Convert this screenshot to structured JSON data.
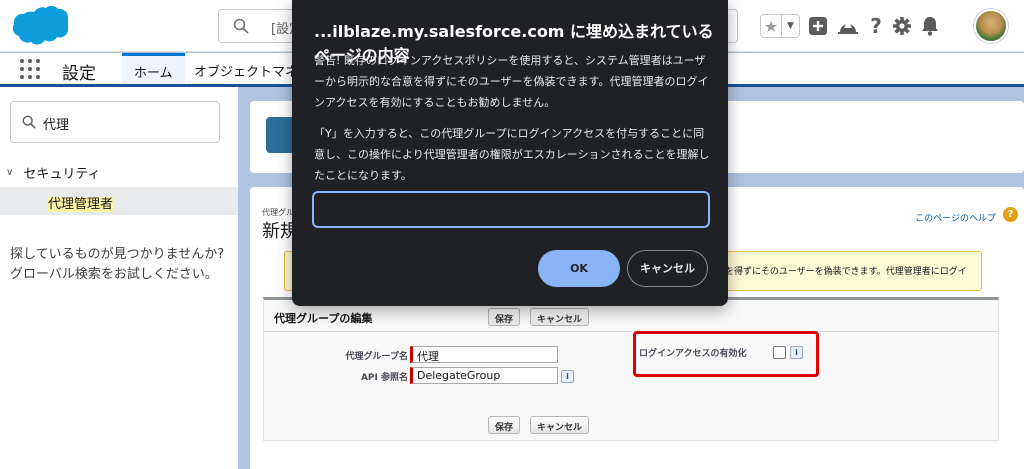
{
  "header": {
    "search_placeholder": "[設定",
    "icons": [
      "favorite-star-icon",
      "favorites-dropdown-icon",
      "global-actions-icon",
      "trailhead-guidance-icon",
      "help-icon",
      "setup-gear-icon",
      "notifications-bell-icon"
    ]
  },
  "nav": {
    "app_name": "設定",
    "tabs": [
      {
        "label": "ホーム",
        "active": true
      },
      {
        "label": "オブジェクトマネ"
      }
    ]
  },
  "sidebar": {
    "quick_find_value": "代理",
    "section": "セキュリティ",
    "item": "代理管理者",
    "not_found_line1": "探しているものが見つかりませんか?",
    "not_found_line2": "グローバル検索をお試しください。"
  },
  "page": {
    "breadcrumb": "代理グル",
    "title": "新規",
    "help_link": "このページのヘルプ",
    "message_visible": "を得ずにそのユーザーを偽装できます。代理管理者にログイ",
    "panel_title": "代理グループの編集",
    "save_label": "保存",
    "cancel_label": "キャンセル",
    "group_name_label": "代理グループ名",
    "group_name_value": "代理",
    "api_name_label": "API 参照名",
    "api_name_value": "DelegateGroup",
    "login_access_label": "ログインアクセスの有効化",
    "login_access_checked": false
  },
  "dialog": {
    "title": "...ilblaze.my.salesforce.com に埋め込まれているページの内容",
    "message_1": "警告! 既存のログインアクセスポリシーを使用すると、システム管理者はユーザーから明示的な合意を得ずにそのユーザーを偽装できます。代理管理者のログインアクセスを有効にすることもお勧めしません。",
    "message_2": "「Y」を入力すると、この代理グループにログインアクセスを付与することに同意し、この操作により代理管理者の権限がエスカレーションされることを理解したことになります。",
    "input_value": "",
    "ok_label": "OK",
    "cancel_label": "キャンセル"
  },
  "colors": {
    "brand_blue": "#0176d3",
    "setup_bg": "#b0c4df",
    "dialog_bg": "#202124",
    "dialog_accent": "#8ab4f8",
    "highlight_red": "#e00000"
  }
}
